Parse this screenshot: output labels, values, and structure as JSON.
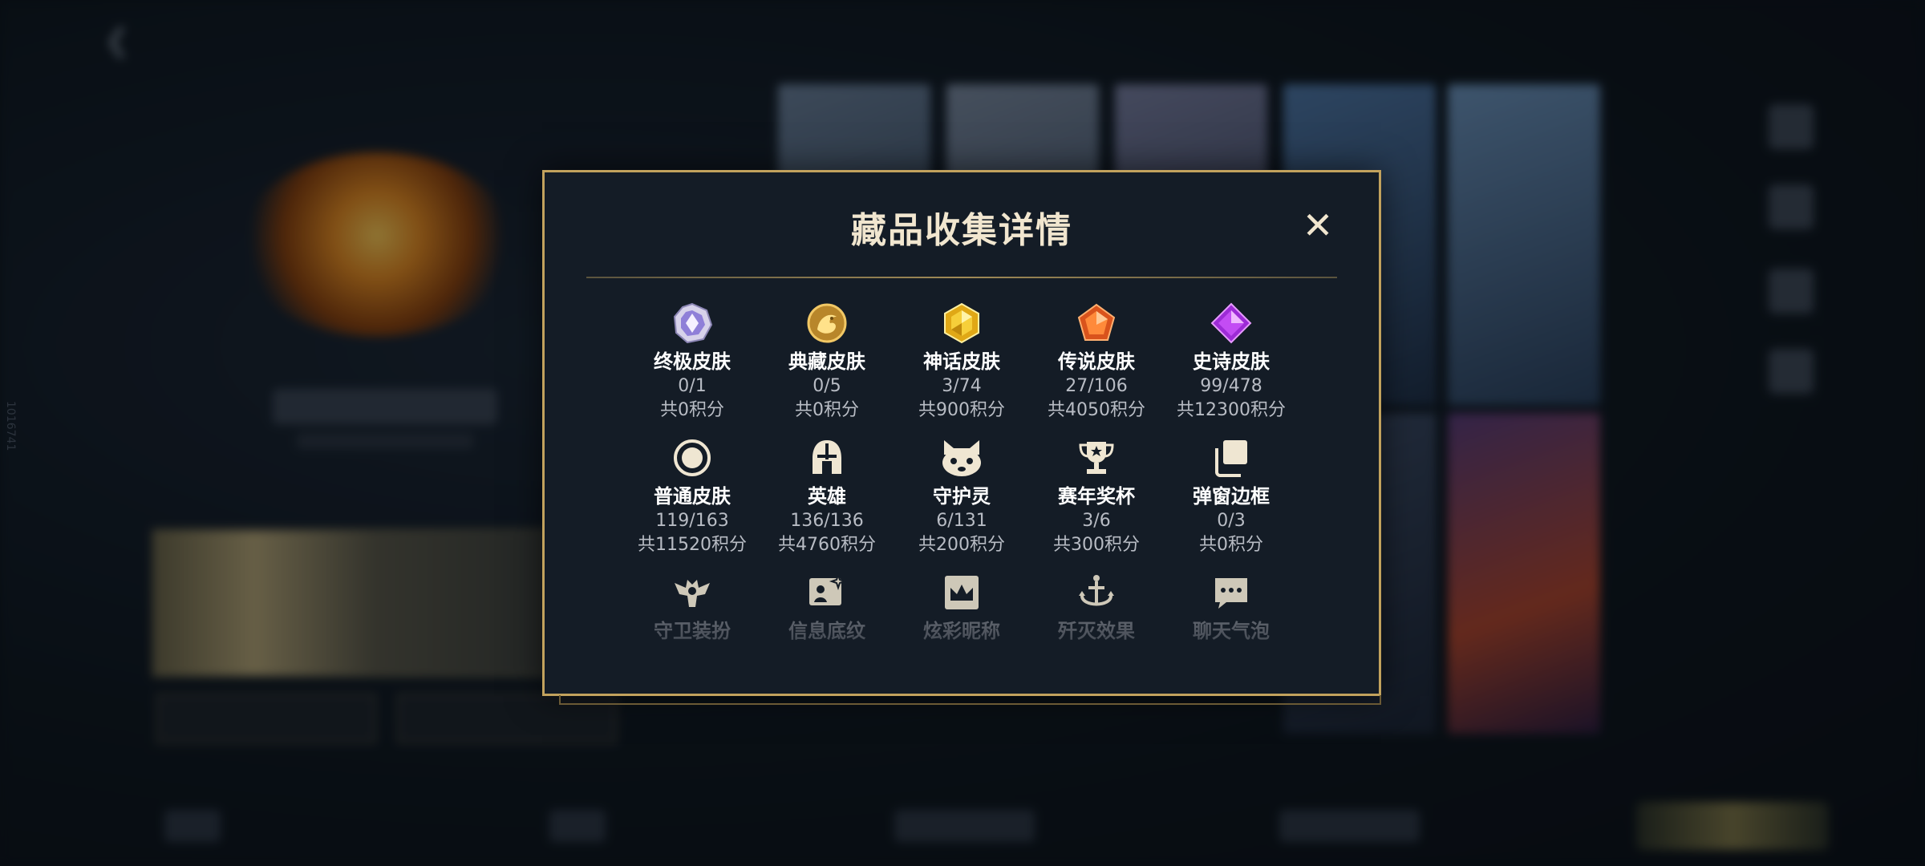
{
  "modal": {
    "title": "藏品收集详情",
    "close_label": "✕"
  },
  "categories": [
    {
      "name": "终极皮肤",
      "count": "0/1",
      "points": "共0积分",
      "icon": "ultimate-skin-icon"
    },
    {
      "name": "典藏皮肤",
      "count": "0/5",
      "points": "共0积分",
      "icon": "collection-skin-icon"
    },
    {
      "name": "神话皮肤",
      "count": "3/74",
      "points": "共900积分",
      "icon": "mythic-skin-icon"
    },
    {
      "name": "传说皮肤",
      "count": "27/106",
      "points": "共4050积分",
      "icon": "legendary-skin-icon"
    },
    {
      "name": "史诗皮肤",
      "count": "99/478",
      "points": "共12300积分",
      "icon": "epic-skin-icon"
    },
    {
      "name": "普通皮肤",
      "count": "119/163",
      "points": "共11520积分",
      "icon": "normal-skin-icon"
    },
    {
      "name": "英雄",
      "count": "136/136",
      "points": "共4760积分",
      "icon": "hero-helmet-icon"
    },
    {
      "name": "守护灵",
      "count": "6/131",
      "points": "共200积分",
      "icon": "guardian-spirit-icon"
    },
    {
      "name": "赛年奖杯",
      "count": "3/6",
      "points": "共300积分",
      "icon": "trophy-icon"
    },
    {
      "name": "弹窗边框",
      "count": "0/3",
      "points": "共0积分",
      "icon": "popup-frame-icon"
    },
    {
      "name": "守卫装扮",
      "icon": "guard-outfit-icon"
    },
    {
      "name": "信息底纹",
      "icon": "info-pattern-icon"
    },
    {
      "name": "炫彩昵称",
      "icon": "colorful-nickname-icon"
    },
    {
      "name": "歼灭效果",
      "icon": "annihilation-effect-icon"
    },
    {
      "name": "聊天气泡",
      "icon": "chat-bubble-icon"
    }
  ],
  "background": {
    "side_id": "1016741"
  },
  "colors": {
    "gold_border": "#c2a25d",
    "panel_bg": "#141c26",
    "title_text": "#f1e6cf",
    "stat_text": "#b8bcc4"
  }
}
